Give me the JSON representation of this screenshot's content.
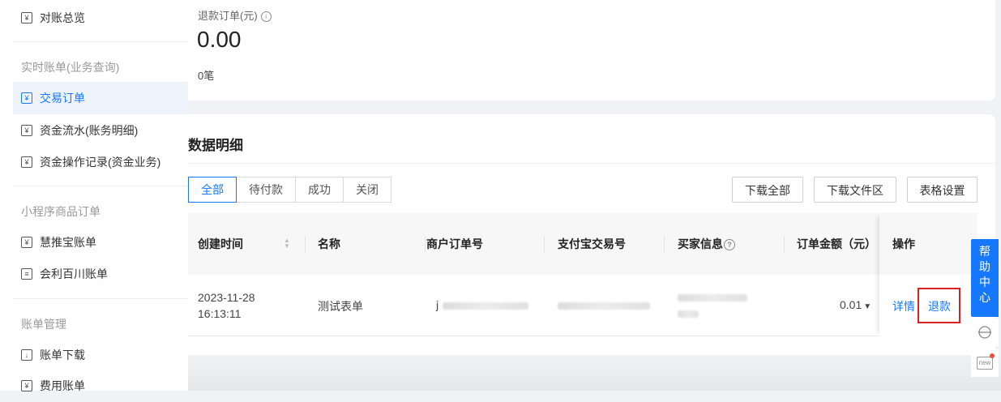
{
  "sidebar": {
    "overview": "对账总览",
    "group_realtime": "实时账单(业务查询)",
    "trade_orders": "交易订单",
    "fund_flow": "资金流水(账务明细)",
    "fund_ops": "资金操作记录(资金业务)",
    "group_mini": "小程序商品订单",
    "huituibao": "慧推宝账单",
    "huili": "会利百川账单",
    "group_manage": "账单管理",
    "bill_download": "账单下载",
    "fee_bill": "费用账单"
  },
  "summary": {
    "label": "退款订单(元)",
    "amount": "0.00",
    "count": "0笔"
  },
  "details": {
    "title": "数据明细",
    "tabs": [
      "全部",
      "待付款",
      "成功",
      "关闭"
    ],
    "active_tab": "全部",
    "buttons": {
      "download_all": "下载全部",
      "download_folder": "下载文件区",
      "table_settings": "表格设置"
    },
    "columns": {
      "created": "创建时间",
      "name": "名称",
      "merchant_order": "商户订单号",
      "alipay_trade": "支付宝交易号",
      "buyer": "买家信息",
      "amount": "订单金额（元）",
      "ops": "操作"
    },
    "rows": [
      {
        "created_date": "2023-11-28",
        "created_time": "16:13:11",
        "name": "测试表单",
        "merchant_order_prefix": "j",
        "amount": "0.01",
        "detail": "详情",
        "refund": "退款"
      }
    ]
  },
  "help": {
    "chars": [
      "帮",
      "助",
      "中",
      "心"
    ],
    "new_badge": "new"
  },
  "colors": {
    "accent": "#1677ff",
    "highlight_box": "#e02020"
  }
}
